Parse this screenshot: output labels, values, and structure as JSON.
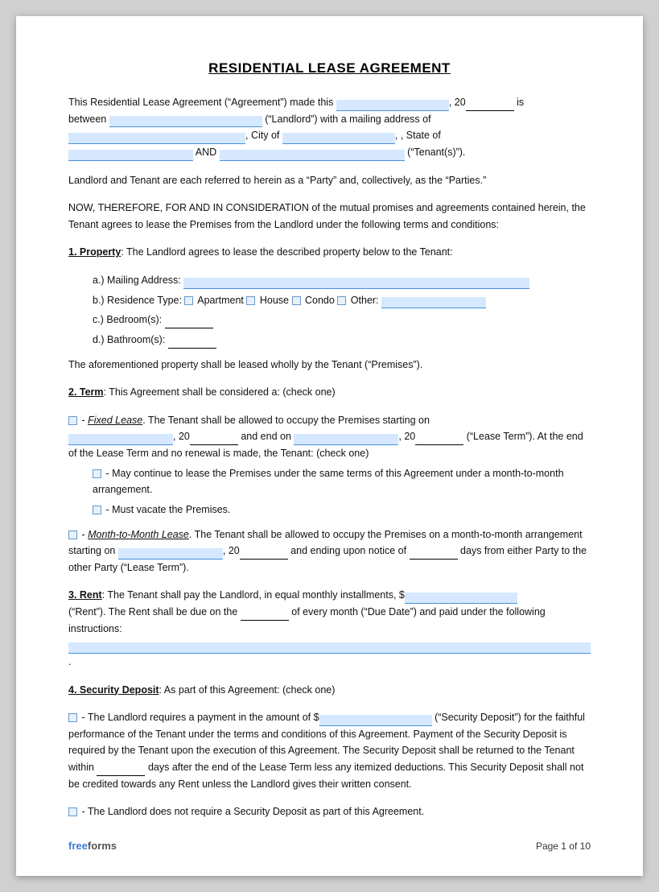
{
  "title": "RESIDENTIAL LEASE AGREEMENT",
  "intro": {
    "line1_pre": "This Residential Lease Agreement (“Agreement”) made this",
    "line1_year": "20",
    "line1_post": "is",
    "line2_pre": "between",
    "line2_mid": "(“Landlord”) with a mailing address of",
    "line3_city_pre": "City of",
    "line3_post": ", State of",
    "line4_and": "AND",
    "line4_post": "(“Tenant(s)”)."
  },
  "parties_text": "Landlord and Tenant are each referred to herein as a “Party” and, collectively, as the “Parties.”",
  "consideration_text": "NOW, THEREFORE, FOR AND IN CONSIDERATION of the mutual promises and agreements contained herein, the Tenant agrees to lease the Premises from the Landlord under the following terms and conditions:",
  "section1": {
    "heading": "1. Property",
    "text": ": The Landlord agrees to lease the described property below to the Tenant:",
    "a_label": "a.)  Mailing Address:",
    "b_label": "b.)  Residence Type:",
    "b_apartment": "Apartment",
    "b_house": "House",
    "b_condo": "Condo",
    "b_other": "Other:",
    "c_label": "c.)  Bedroom(s):",
    "d_label": "d.)  Bathroom(s):",
    "closing_text": "The aforementioned property shall be leased wholly by the Tenant (“Premises”)."
  },
  "section2": {
    "heading": "2. Term",
    "text": ": This Agreement shall be considered a: (check one)",
    "fixed_lease_label": "Fixed Lease",
    "fixed_lease_pre": ". The Tenant shall be allowed to occupy the Premises starting on",
    "fixed_year1": "20",
    "fixed_end_pre": "and end on",
    "fixed_year2": "20",
    "fixed_end_post": "(“Lease Term”). At the end of the Lease Term and no renewal is made, the Tenant: (check one)",
    "option1": "- May continue to lease the Premises under the same terms of this Agreement under a month-to-month arrangement.",
    "option2": "- Must vacate the Premises.",
    "month_label": "Month-to-Month Lease",
    "month_pre": ". The Tenant shall be allowed to occupy the Premises on a month-to-month arrangement starting on",
    "month_year": "20",
    "month_end": "and ending upon notice of",
    "month_days": "days from either Party to the other Party (“Lease Term”)."
  },
  "section3": {
    "heading": "3. Rent",
    "text": ": The Tenant shall pay the Landlord, in equal monthly installments, $",
    "text2": "(“Rent”). The Rent shall be due on the",
    "text3": "of every month (“Due Date”) and paid under the following instructions:",
    "text4": "."
  },
  "section4": {
    "heading": "4. Security Deposit",
    "text": ": As part of this Agreement: (check one)",
    "option1_pre": "- The Landlord requires a payment in the amount of $",
    "option1_post": "(“Security Deposit”) for the faithful performance of the Tenant under the terms and conditions of this Agreement. Payment of the Security Deposit is required by the Tenant upon the execution of this Agreement. The Security Deposit shall be returned to the Tenant within",
    "option1_days_after": "days after the end of the Lease Term less any itemized deductions. This Security Deposit shall not be credited towards any Rent unless the Landlord gives their written consent.",
    "option2": "- The Landlord does not require a Security Deposit as part of this Agreement."
  },
  "footer": {
    "brand_free": "free",
    "brand_forms": "forms",
    "page_label": "Page 1 of 10"
  }
}
